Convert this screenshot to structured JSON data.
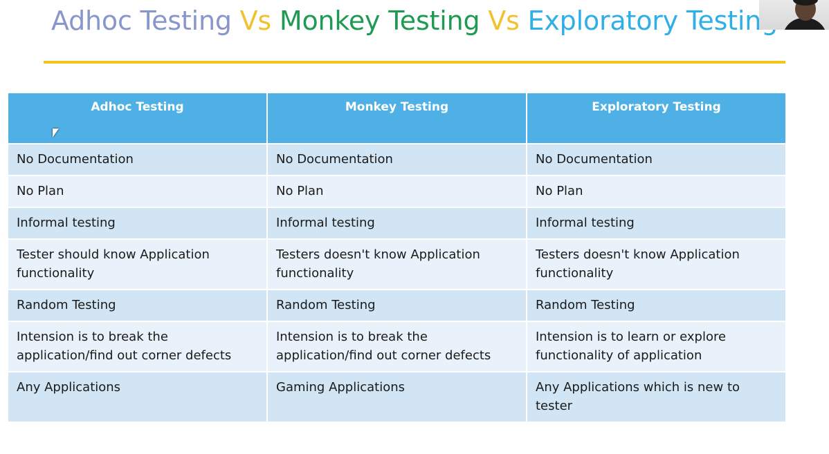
{
  "title": {
    "part1": "Adhoc Testing",
    "vs1": " Vs ",
    "part2": "Monkey Testing",
    "vs2": " Vs ",
    "part3": "Exploratory Testing"
  },
  "colors": {
    "adhoc": "#8896cb",
    "vs": "#f2c130",
    "monkey": "#1e9a52",
    "exploratory": "#2faee8",
    "rule": "#f5c518",
    "header_bg": "#4fb0e6",
    "row_dark": "#d1e5f4",
    "row_light": "#e9f2fa"
  },
  "table": {
    "headers": [
      "Adhoc Testing",
      "Monkey Testing",
      "Exploratory Testing"
    ],
    "rows": [
      [
        "No Documentation",
        "No Documentation",
        "No Documentation"
      ],
      [
        "No Plan",
        "No Plan",
        "No Plan"
      ],
      [
        "Informal testing",
        "Informal testing",
        "Informal testing"
      ],
      [
        "Tester should know Application functionality",
        "Testers doesn't know Application functionality",
        "Testers doesn't know Application functionality"
      ],
      [
        "Random Testing",
        "Random Testing",
        "Random Testing"
      ],
      [
        "Intension is to break the application/find out corner defects",
        "Intension is to break the application/find out corner defects",
        "Intension is to learn or explore functionality of application"
      ],
      [
        "Any Applications",
        "Gaming Applications",
        "Any Applications which is new to tester"
      ]
    ]
  }
}
